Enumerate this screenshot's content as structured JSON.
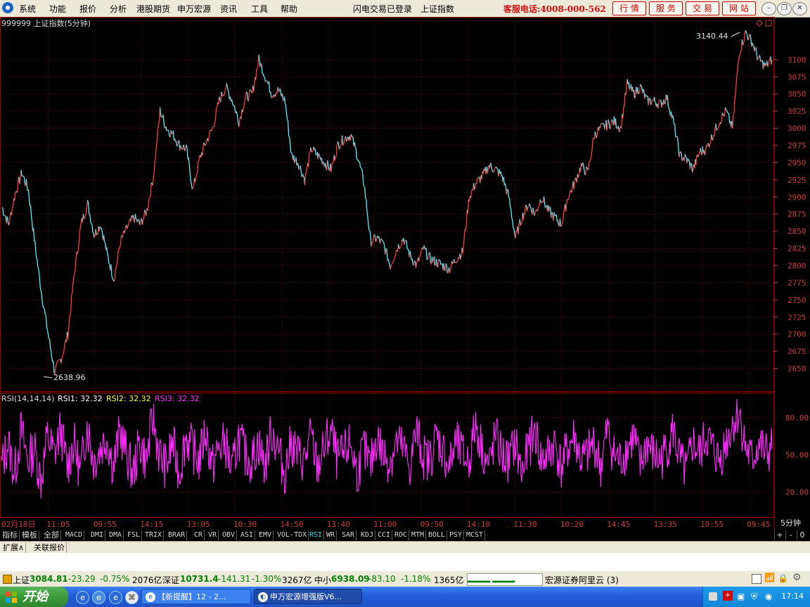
{
  "menubar": {
    "items": [
      "系统",
      "功能",
      "报价",
      "分析",
      "港股期货",
      "申万宏源",
      "资讯",
      "工具",
      "帮助"
    ],
    "login_status": "闪电交易已登录",
    "index_name": "上证指数",
    "hotline": "客服电话:4008-000-562",
    "buttons": [
      "行 情",
      "服 务",
      "交 易",
      "网 站"
    ],
    "window_controls": [
      "minimize-icon",
      "restore-icon",
      "close-icon"
    ]
  },
  "chart": {
    "header": "999999 上证指数(5分钟)",
    "price_max_label": "3140.44",
    "price_min_label": "2638.96",
    "price_axis_ticks": [
      "3100",
      "3075",
      "3050",
      "3025",
      "3000",
      "2975",
      "2950",
      "2925",
      "2900",
      "2875",
      "2850",
      "2825",
      "2800",
      "2775",
      "2750",
      "2725",
      "2700",
      "2675",
      "2650"
    ],
    "rsi_header": "RSI(14,14,14)",
    "rsi1_label": "RSI1: 32.32",
    "rsi2_label": "RSI2: 32.32",
    "rsi3_label": "RSI3: 32.32",
    "rsi_axis_ticks": [
      "80.00",
      "50.00",
      "20.00"
    ],
    "time_ticks": [
      "02月18日",
      "11:05",
      "09:55",
      "14:15",
      "13:05",
      "10:30",
      "14:50",
      "13:40",
      "11:00",
      "09:50",
      "14:10",
      "11:30",
      "10:20",
      "14:45",
      "13:35",
      "10:55",
      "09:45"
    ],
    "period_label": "5分钟",
    "colors": {
      "up": "#ff3c3c",
      "down": "#54f2ff",
      "rsi": "#ff2cff",
      "grid": "#7a0000",
      "axis": "#c83c3c",
      "rsi2": "#ffff40"
    }
  },
  "chart_data": {
    "type": "line",
    "title": "999999 上证指数(5分钟)",
    "xlabel": "",
    "ylabel": "",
    "series": [
      {
        "name": "上证指数",
        "values": [
          2885,
          2860,
          2905,
          2935,
          2910,
          2830,
          2760,
          2700,
          2645,
          2665,
          2700,
          2790,
          2860,
          2890,
          2845,
          2860,
          2815,
          2780,
          2835,
          2855,
          2870,
          2860,
          2880,
          2930,
          3025,
          3000,
          2990,
          2975,
          2970,
          2910,
          2955,
          2980,
          3000,
          3040,
          3060,
          3040,
          3010,
          3045,
          3050,
          3100,
          3075,
          3050,
          3055,
          3040,
          2960,
          2950,
          2925,
          2970,
          2960,
          2950,
          2940,
          2975,
          2985,
          2990,
          2960,
          2920,
          2835,
          2840,
          2830,
          2800,
          2825,
          2840,
          2815,
          2800,
          2825,
          2810,
          2805,
          2800,
          2795,
          2810,
          2820,
          2900,
          2920,
          2930,
          2945,
          2940,
          2930,
          2900,
          2840,
          2870,
          2890,
          2875,
          2900,
          2880,
          2870,
          2860,
          2900,
          2920,
          2945,
          2935,
          2990,
          3000,
          3005,
          3010,
          3000,
          3065,
          3050,
          3060,
          3040,
          3040,
          3035,
          3045,
          3010,
          2960,
          2955,
          2940,
          2965,
          2970,
          2990,
          3010,
          3025,
          3000,
          3110,
          3140,
          3125,
          3100,
          3090,
          3100
        ]
      },
      {
        "name": "RSI1",
        "values": [
          40,
          60,
          35,
          70,
          45,
          55,
          30,
          65,
          50,
          70,
          40,
          60,
          35,
          75,
          45,
          55,
          65,
          40,
          70,
          50,
          35,
          60,
          45,
          80,
          50,
          40,
          60,
          35,
          65,
          55,
          45,
          70,
          40,
          55,
          60,
          35,
          65,
          50,
          45,
          60,
          40,
          70,
          55,
          35,
          60,
          50,
          45,
          65,
          40,
          55,
          70,
          45,
          50,
          60,
          35,
          55,
          40,
          65,
          50,
          45,
          60,
          55,
          40,
          70,
          50,
          45,
          65,
          55,
          40,
          60,
          50,
          45,
          75,
          55,
          40,
          65,
          50,
          45,
          60,
          35,
          55,
          70,
          45,
          50,
          60,
          40,
          55,
          65,
          45,
          50,
          60,
          40,
          70,
          50,
          45,
          55,
          65,
          40,
          60,
          50,
          45,
          55,
          70,
          45,
          35,
          60,
          50,
          65,
          55,
          45,
          60,
          75,
          85,
          55,
          45,
          60,
          50,
          55
        ]
      }
    ],
    "ylim": [
      2625,
      3150
    ],
    "rsi_ylim": [
      0,
      100
    ]
  },
  "tabs": {
    "items": [
      "指标",
      "模板",
      "全部",
      "MACD",
      "DMI",
      "DMA",
      "FSL",
      "TRIX",
      "BRAR",
      "CR",
      "VR",
      "OBV",
      "ASI",
      "EMV",
      "VOL-TDX",
      "RSI",
      "WR",
      "SAR",
      "KDJ",
      "CCI",
      "ROC",
      "MTM",
      "BOLL",
      "PSY",
      "MCST"
    ],
    "selected": "RSI",
    "zoom": [
      "+",
      "-",
      "0"
    ]
  },
  "expand_row": {
    "expand": "扩展∧",
    "related": "关联报价"
  },
  "status": {
    "sh_name": "上证",
    "sh_value": "3084.81",
    "sh_change": "-23.29",
    "sh_pct": "-0.75%",
    "sh_amount": "2076亿",
    "sz_name": "深证",
    "sz_value": "10731.4",
    "sz_change": "-141.31",
    "sz_pct": "-1.30%",
    "sz_amount": "3267亿",
    "zx_name": "中小",
    "zx_value": "6938.09",
    "zx_change": "-83.10",
    "zx_pct": "-1.18%",
    "zx_amount": "1365亿",
    "broker": "宏源证券阿里云 (3)"
  },
  "taskbar": {
    "start": "开始",
    "tasks": [
      "【新提醒】12 - 2...",
      "申万宏源增强版V6..."
    ],
    "clock": "17:14"
  }
}
